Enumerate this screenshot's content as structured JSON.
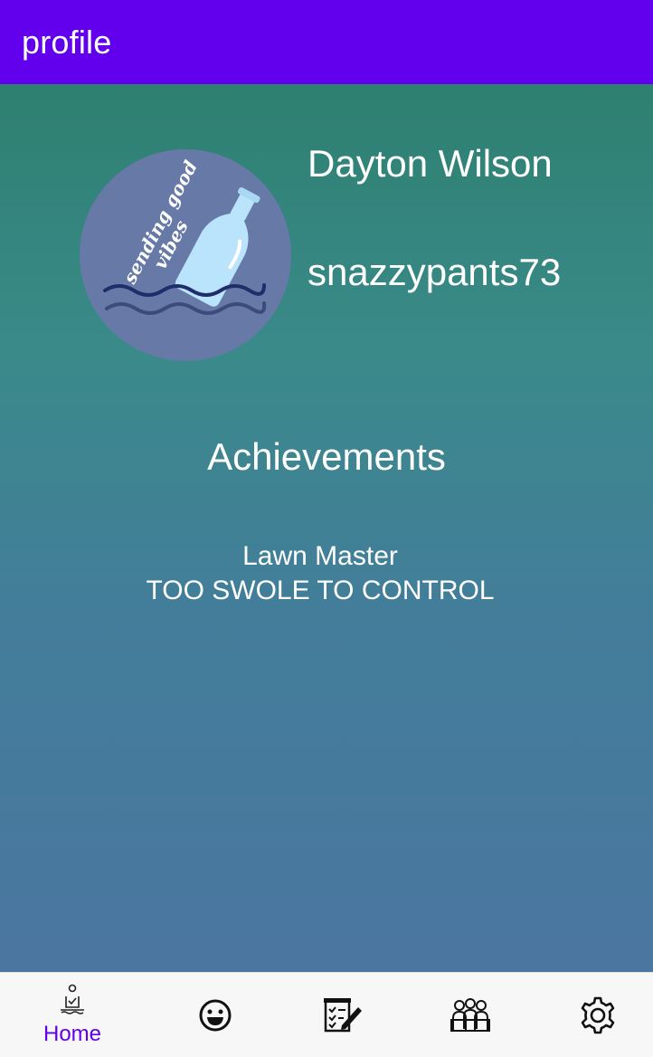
{
  "appbar": {
    "title": "profile",
    "color": "#6200EE"
  },
  "profile": {
    "avatar_text": [
      "sending good",
      "vibes"
    ],
    "name": "Dayton Wilson",
    "username": "snazzypants73"
  },
  "achievements": {
    "title": "Achievements",
    "items": [
      "Lawn Master",
      "TOO SWOLE TO CONTROL"
    ]
  },
  "bottom_nav": {
    "items": [
      {
        "icon": "home-icon",
        "label": "Home",
        "active": true
      },
      {
        "icon": "smiley-face-icon",
        "label": "",
        "active": false
      },
      {
        "icon": "checklist-edit-icon",
        "label": "",
        "active": false
      },
      {
        "icon": "group-icon",
        "label": "",
        "active": false
      },
      {
        "icon": "gear-icon",
        "label": "",
        "active": false
      }
    ],
    "active_color": "#6200EE"
  }
}
